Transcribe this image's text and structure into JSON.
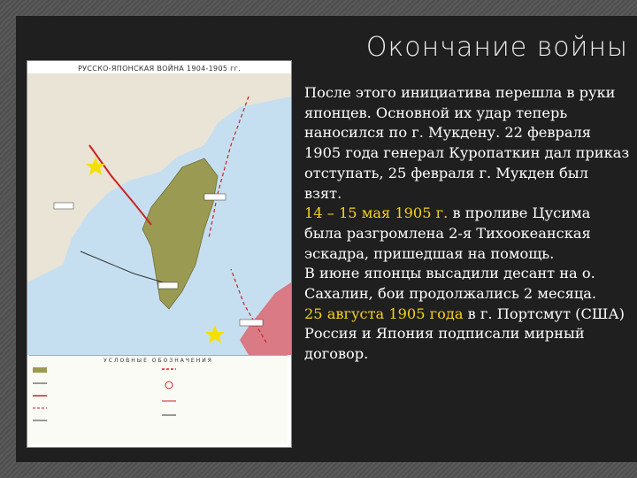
{
  "slide": {
    "title": "Окончание войны",
    "paragraphs": [
      {
        "parts": [
          {
            "text": "После этого инициатива перешла в руки японцев. Основной их удар теперь наносился по г. Мукдену. 22 февраля 1905 года генерал Куропаткин дал приказ отступать, 25 февраля г. Мукден был взят.",
            "hl": false
          }
        ]
      },
      {
        "parts": [
          {
            "text": "14 – 15 мая 1905 г.",
            "hl": true
          },
          {
            "text": " в проливе Цусима была разгромлена 2-я Тихоокеанская эскадра, пришедшая на помощь.",
            "hl": false
          }
        ]
      },
      {
        "parts": [
          {
            "text": "В июне японцы высадили десант на о. Сахалин, бои продолжались 2 месяца.",
            "hl": false
          }
        ]
      },
      {
        "parts": [
          {
            "text": "25 августа 1905 года",
            "hl": true
          },
          {
            "text": " в г. Портсмут (США) Россия и Япония подписали мирный договор.",
            "hl": false
          }
        ]
      }
    ]
  },
  "map": {
    "title": "РУССКО-ЯПОНСКАЯ ВОЙНА 1904-1905 гг.",
    "legend_title": "УСЛОВНЫЕ ОБОЗНАЧЕНИЯ",
    "colors": {
      "land": "#e9e4d6",
      "korea": "#9a9a52",
      "japan": "#d97a85",
      "sea": "#c6dff0",
      "water_text": "#6b8fae"
    }
  }
}
